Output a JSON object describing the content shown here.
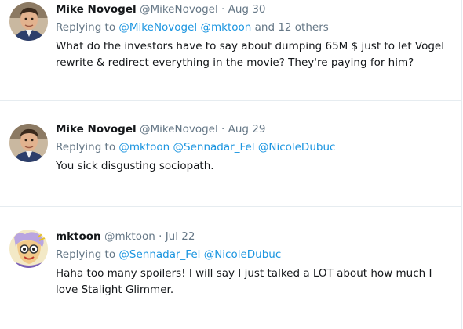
{
  "tweets": [
    {
      "author_name": "Mike Novogel",
      "author_handle": "@MikeNovogel",
      "separator": "·",
      "date": "Aug 30",
      "replying_prefix": "Replying to",
      "mentions": [
        "@MikeNovogel",
        "@mktoon"
      ],
      "others_text": "and 12 others",
      "text": "What do the investors have to say about dumping 65M $ just to let Vogel rewrite & redirect everything in the movie? They're paying for him?",
      "avatar_icon": "profile-photo-icon"
    },
    {
      "author_name": "Mike Novogel",
      "author_handle": "@MikeNovogel",
      "separator": "·",
      "date": "Aug 29",
      "replying_prefix": "Replying to",
      "mentions": [
        "@mktoon",
        "@Sennadar_Fel",
        "@NicoleDubuc"
      ],
      "text": "You sick disgusting sociopath.",
      "avatar_icon": "profile-photo-icon"
    },
    {
      "author_name": "mktoon",
      "author_handle": "@mktoon",
      "separator": "·",
      "date": "Jul 22",
      "replying_prefix": "Replying to",
      "mentions": [
        "@Sennadar_Fel",
        "@NicoleDubuc"
      ],
      "text": "Haha too many spoilers! I will say I just talked a LOT about how much I love Stalight Glimmer.",
      "avatar_icon": "cartoon-avatar-icon"
    }
  ],
  "colors": {
    "link": "#1b95e0",
    "secondary_text": "#657786",
    "primary_text": "#14171a",
    "divider": "#e6ecf0"
  }
}
